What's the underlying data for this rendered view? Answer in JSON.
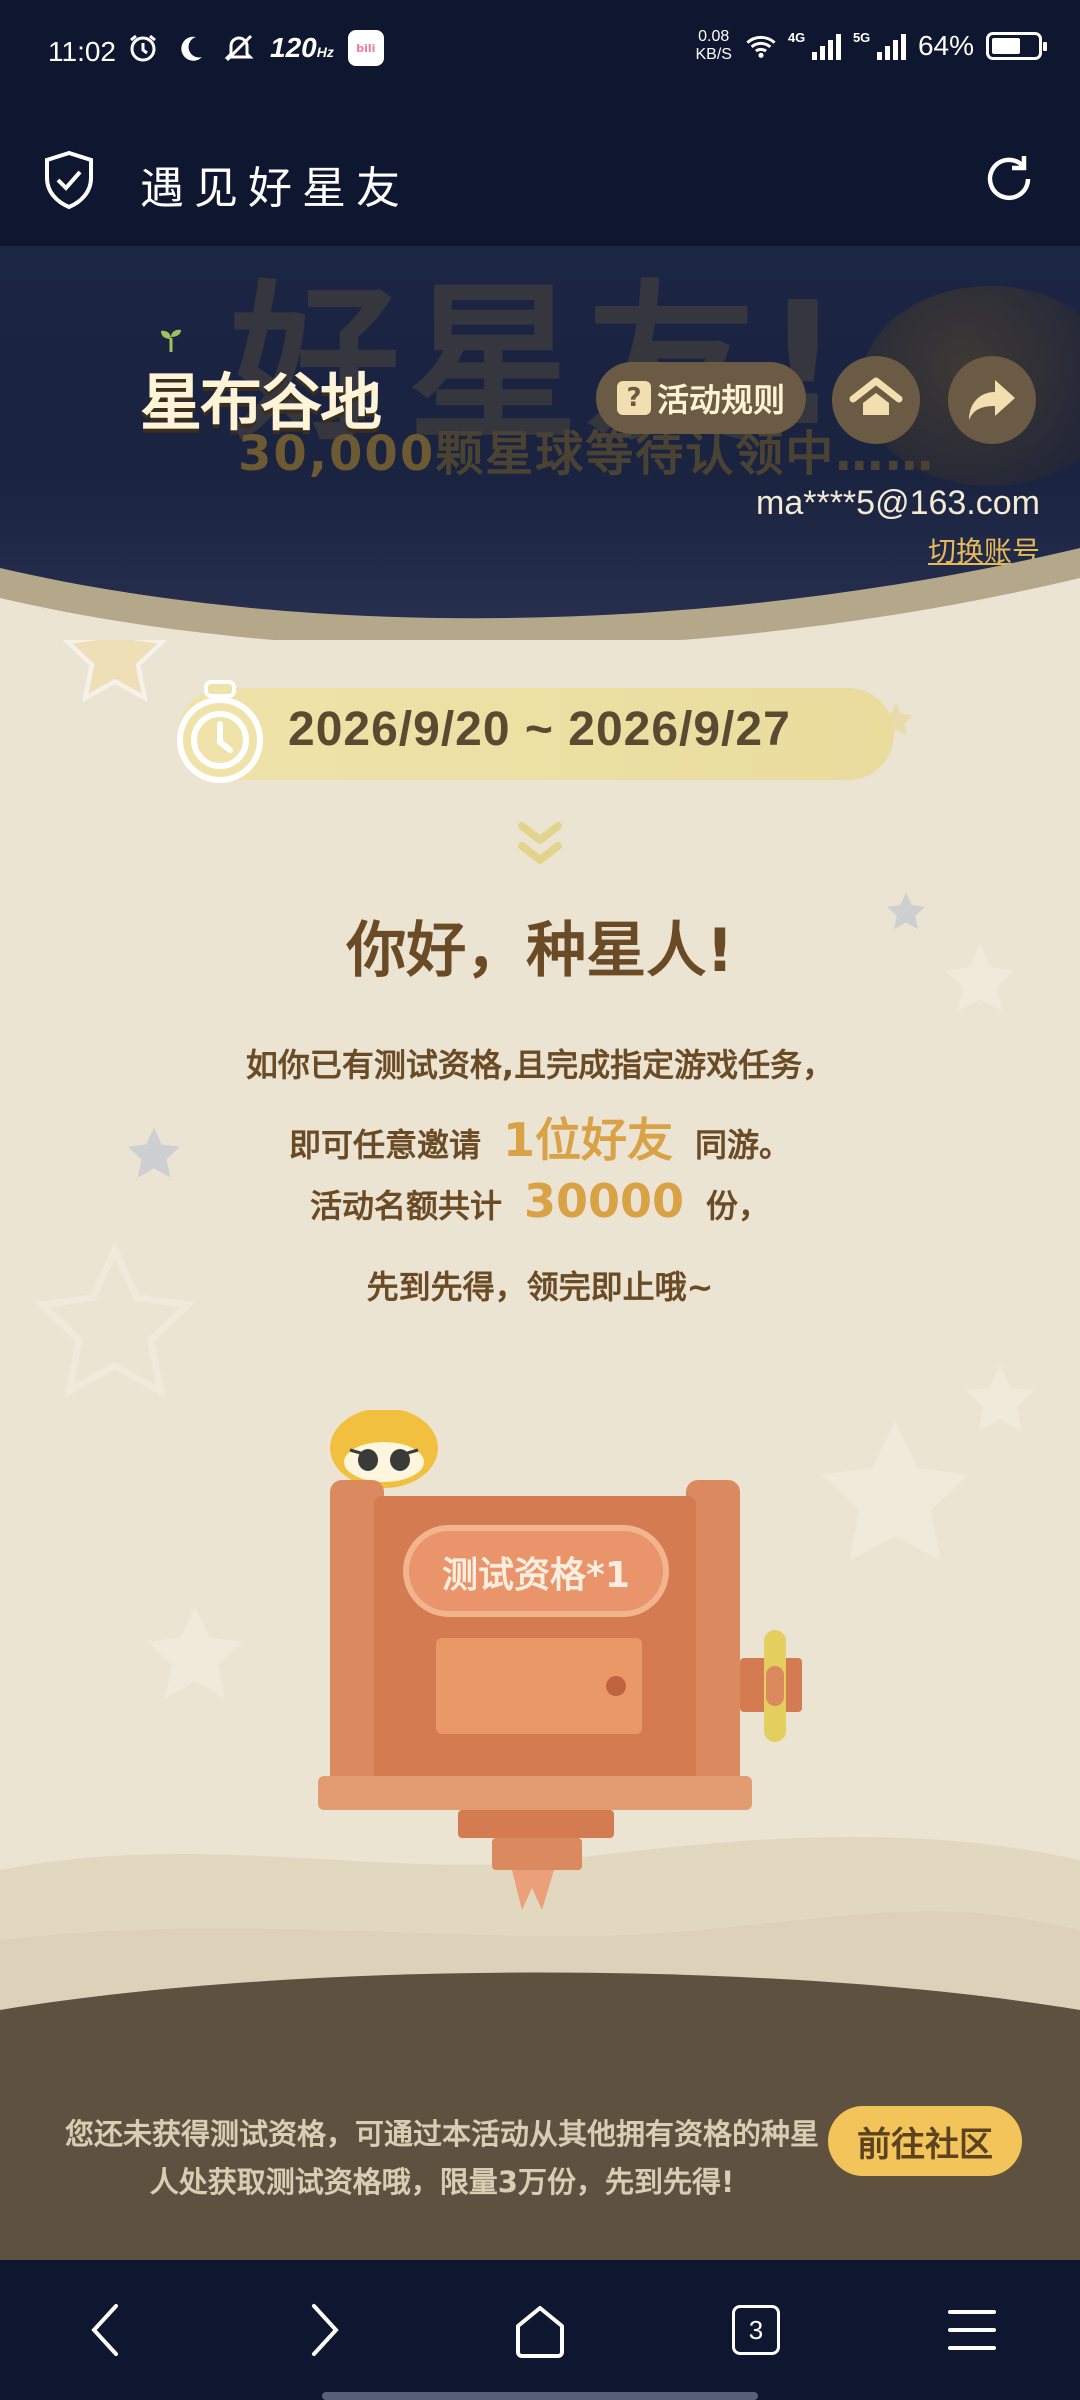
{
  "status_bar": {
    "time": "11:02",
    "refresh_rate": "120",
    "refresh_unit": "Hz",
    "app_badge": "bilibili",
    "net_speed_value": "0.08",
    "net_speed_unit": "KB/S",
    "signal_4g": "4G",
    "signal_5g": "5G",
    "battery": "64%",
    "battery_level": 0.64
  },
  "app_bar": {
    "title": "遇见好星友"
  },
  "hero": {
    "big_text": "好星友!",
    "sub_number": "30,000",
    "sub_text": "颗星球等待认领中……",
    "logo": "星布谷地",
    "rules_label": "活动规则",
    "email": "ma****5@163.com",
    "switch_account": "切换账号"
  },
  "main": {
    "date_range": "2026/9/20 ~ 2026/9/27",
    "greeting": "你好，种星人!",
    "line1": "如你已有测试资格,且完成指定游戏任务，",
    "line2_pre": "即可任意邀请",
    "line2_hl": "1位好友",
    "line2_post": "同游。",
    "line3_pre": "活动名额共计",
    "line3_hl": "30000",
    "line3_post": "份，",
    "line4": "先到先得，领完即止哦~",
    "qualification_label": "测试资格*1"
  },
  "bottom": {
    "message": "您还未获得测试资格，可通过本活动从其他拥有资格的种星人处获取测试资格哦，限量3万份，先到先得!",
    "community_button": "前往社区"
  },
  "nav": {
    "tab_count": "3"
  },
  "colors": {
    "dark_bg": "#0e1630",
    "cream": "#ebe4d3",
    "brown_text": "#6b4b25",
    "gold": "#d9a246",
    "button_yellow": "#f2c45a",
    "box_orange": "#d9825a"
  }
}
